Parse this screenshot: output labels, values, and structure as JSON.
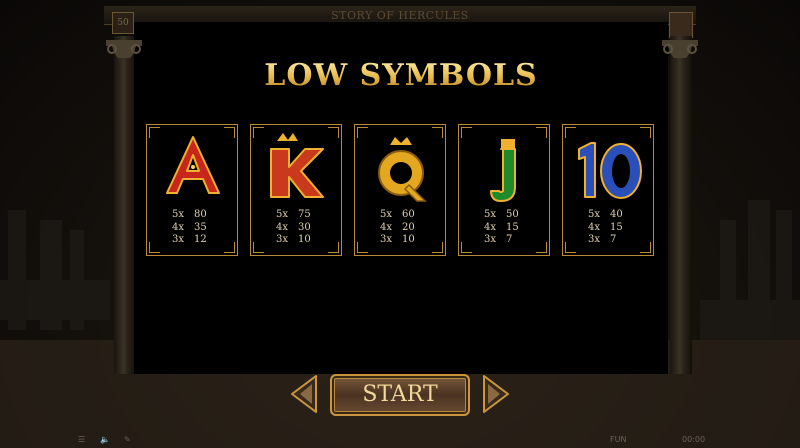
{
  "game": {
    "title": "STORY OF HERCULES",
    "bet_indicator": "50"
  },
  "paytable": {
    "heading": "LOW SYMBOLS",
    "symbols": [
      {
        "symbol": "A",
        "icon": "letter-a-symbol",
        "payouts": [
          {
            "count": "5x",
            "value": "80"
          },
          {
            "count": "4x",
            "value": "35"
          },
          {
            "count": "3x",
            "value": "12"
          }
        ]
      },
      {
        "symbol": "K",
        "icon": "letter-k-symbol",
        "payouts": [
          {
            "count": "5x",
            "value": "75"
          },
          {
            "count": "4x",
            "value": "30"
          },
          {
            "count": "3x",
            "value": "10"
          }
        ]
      },
      {
        "symbol": "Q",
        "icon": "letter-q-symbol",
        "payouts": [
          {
            "count": "5x",
            "value": "60"
          },
          {
            "count": "4x",
            "value": "20"
          },
          {
            "count": "3x",
            "value": "10"
          }
        ]
      },
      {
        "symbol": "J",
        "icon": "letter-j-symbol",
        "payouts": [
          {
            "count": "5x",
            "value": "50"
          },
          {
            "count": "4x",
            "value": "15"
          },
          {
            "count": "3x",
            "value": "7"
          }
        ]
      },
      {
        "symbol": "10",
        "icon": "number-10-symbol",
        "payouts": [
          {
            "count": "5x",
            "value": "40"
          },
          {
            "count": "4x",
            "value": "15"
          },
          {
            "count": "3x",
            "value": "7"
          }
        ]
      }
    ]
  },
  "controls": {
    "start_label": "START",
    "prev_icon": "arrow-left-icon",
    "next_icon": "arrow-right-icon",
    "menu_icon": "menu-icon",
    "sound_icon": "speaker-icon",
    "settings_icon": "wrench-icon",
    "fun_label": "FUN",
    "time_label": "00:00"
  },
  "colors": {
    "gold": "#e6b94a",
    "panel": "#000000",
    "frame": "#b8893a",
    "a_red": "#c8261b",
    "k_red": "#c83a1b",
    "q_gold": "#e3a81f",
    "j_green": "#1f8a2a",
    "ten_blue": "#2a4fb8"
  }
}
